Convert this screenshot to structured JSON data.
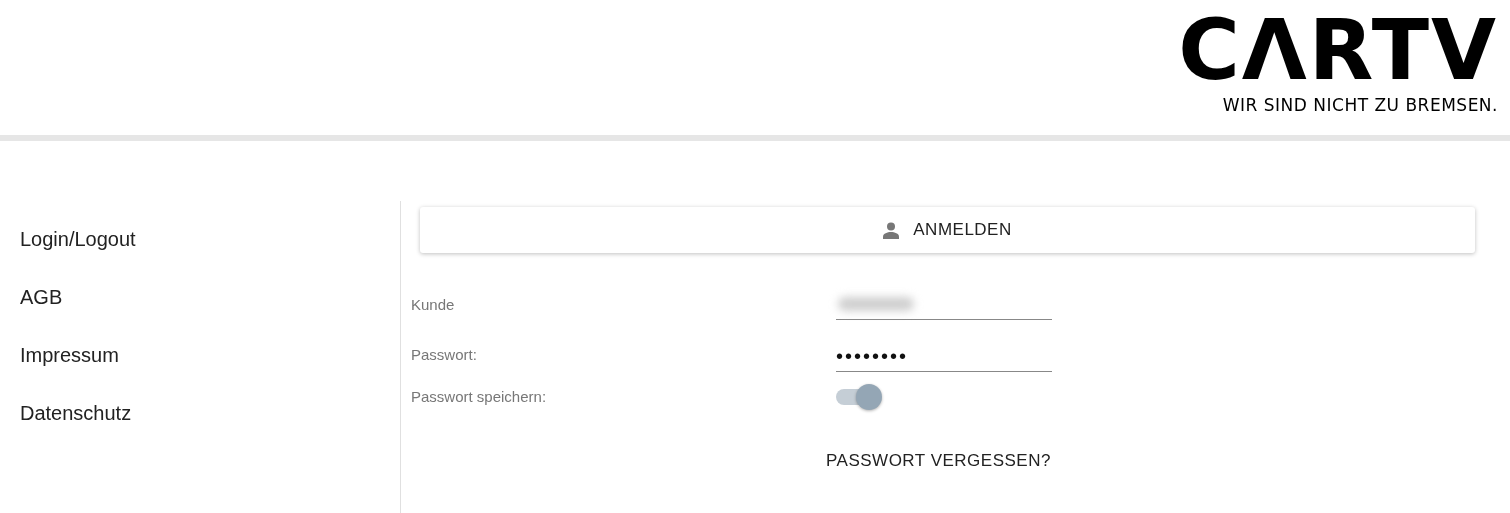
{
  "logo": {
    "wordmark": "CΛRTV",
    "slogan": "WIR SIND NICHT ZU BREMSEN."
  },
  "sidebar": {
    "items": [
      {
        "label": "Login/Logout"
      },
      {
        "label": "AGB"
      },
      {
        "label": "Impressum"
      },
      {
        "label": "Datenschutz"
      }
    ]
  },
  "login": {
    "button": "ANMELDEN",
    "customer": {
      "label": "Kunde",
      "blurred": true
    },
    "password": {
      "label": "Passwort:",
      "value": "••••••••"
    },
    "remember": {
      "label": "Passwort speichern:",
      "on": true
    },
    "forgot": "PASSWORT VERGESSEN?"
  }
}
